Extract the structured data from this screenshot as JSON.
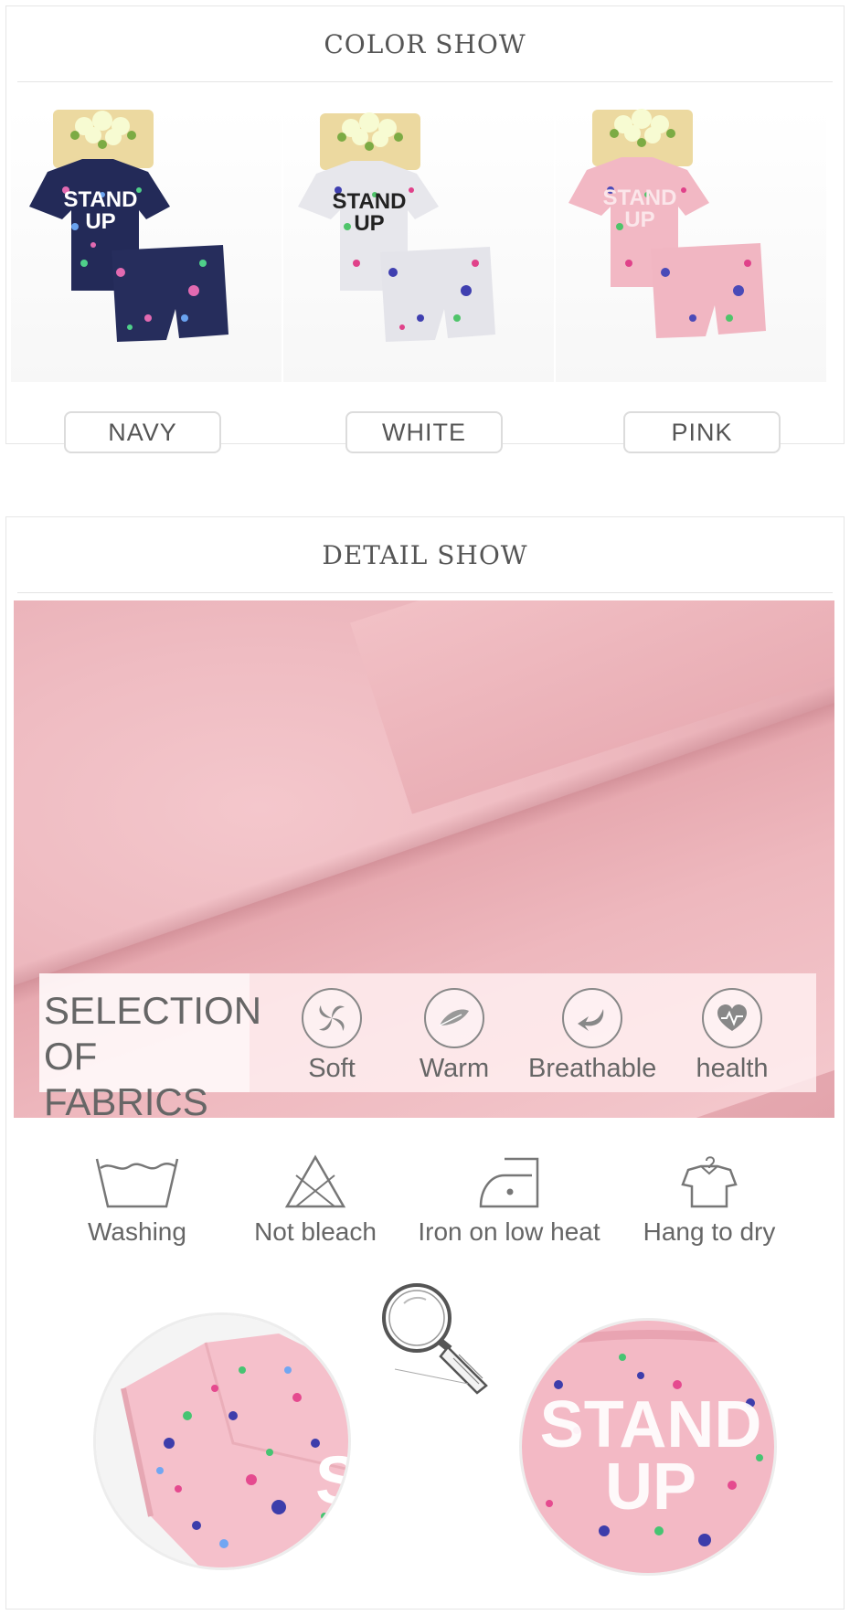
{
  "color_show": {
    "title": "COLOR SHOW",
    "options": [
      {
        "label": "NAVY",
        "shirt_color": "#232a58",
        "print": "STAND UP"
      },
      {
        "label": "WHITE",
        "shirt_color": "#e9e9ee",
        "print": "STAND UP"
      },
      {
        "label": "PINK",
        "shirt_color": "#f2b8c4",
        "print": "STAND UP"
      }
    ]
  },
  "detail_show": {
    "title": "DETAIL SHOW",
    "fabric_heading_line1": "SELECTION",
    "fabric_heading_line2": "OF FABRICS",
    "features": [
      {
        "label": "Soft",
        "icon": "swirl-icon"
      },
      {
        "label": "Warm",
        "icon": "feather-icon"
      },
      {
        "label": "Breathable",
        "icon": "curved-arrow-icon"
      },
      {
        "label": "health",
        "icon": "heart-icon"
      }
    ],
    "care": [
      {
        "label": "Washing",
        "icon": "wash-tub-icon"
      },
      {
        "label": "Not bleach",
        "icon": "no-bleach-icon"
      },
      {
        "label": "Iron on low heat",
        "icon": "iron-icon"
      },
      {
        "label": "Hang to dry",
        "icon": "hanger-shirt-icon"
      }
    ],
    "closeup_right_print_line1": "STAND",
    "closeup_right_print_line2": "UP",
    "closeup_left_print": "S"
  },
  "colors": {
    "border": "#e6e6e6",
    "text": "#555555",
    "fabric_pink": "#efbcc2"
  }
}
